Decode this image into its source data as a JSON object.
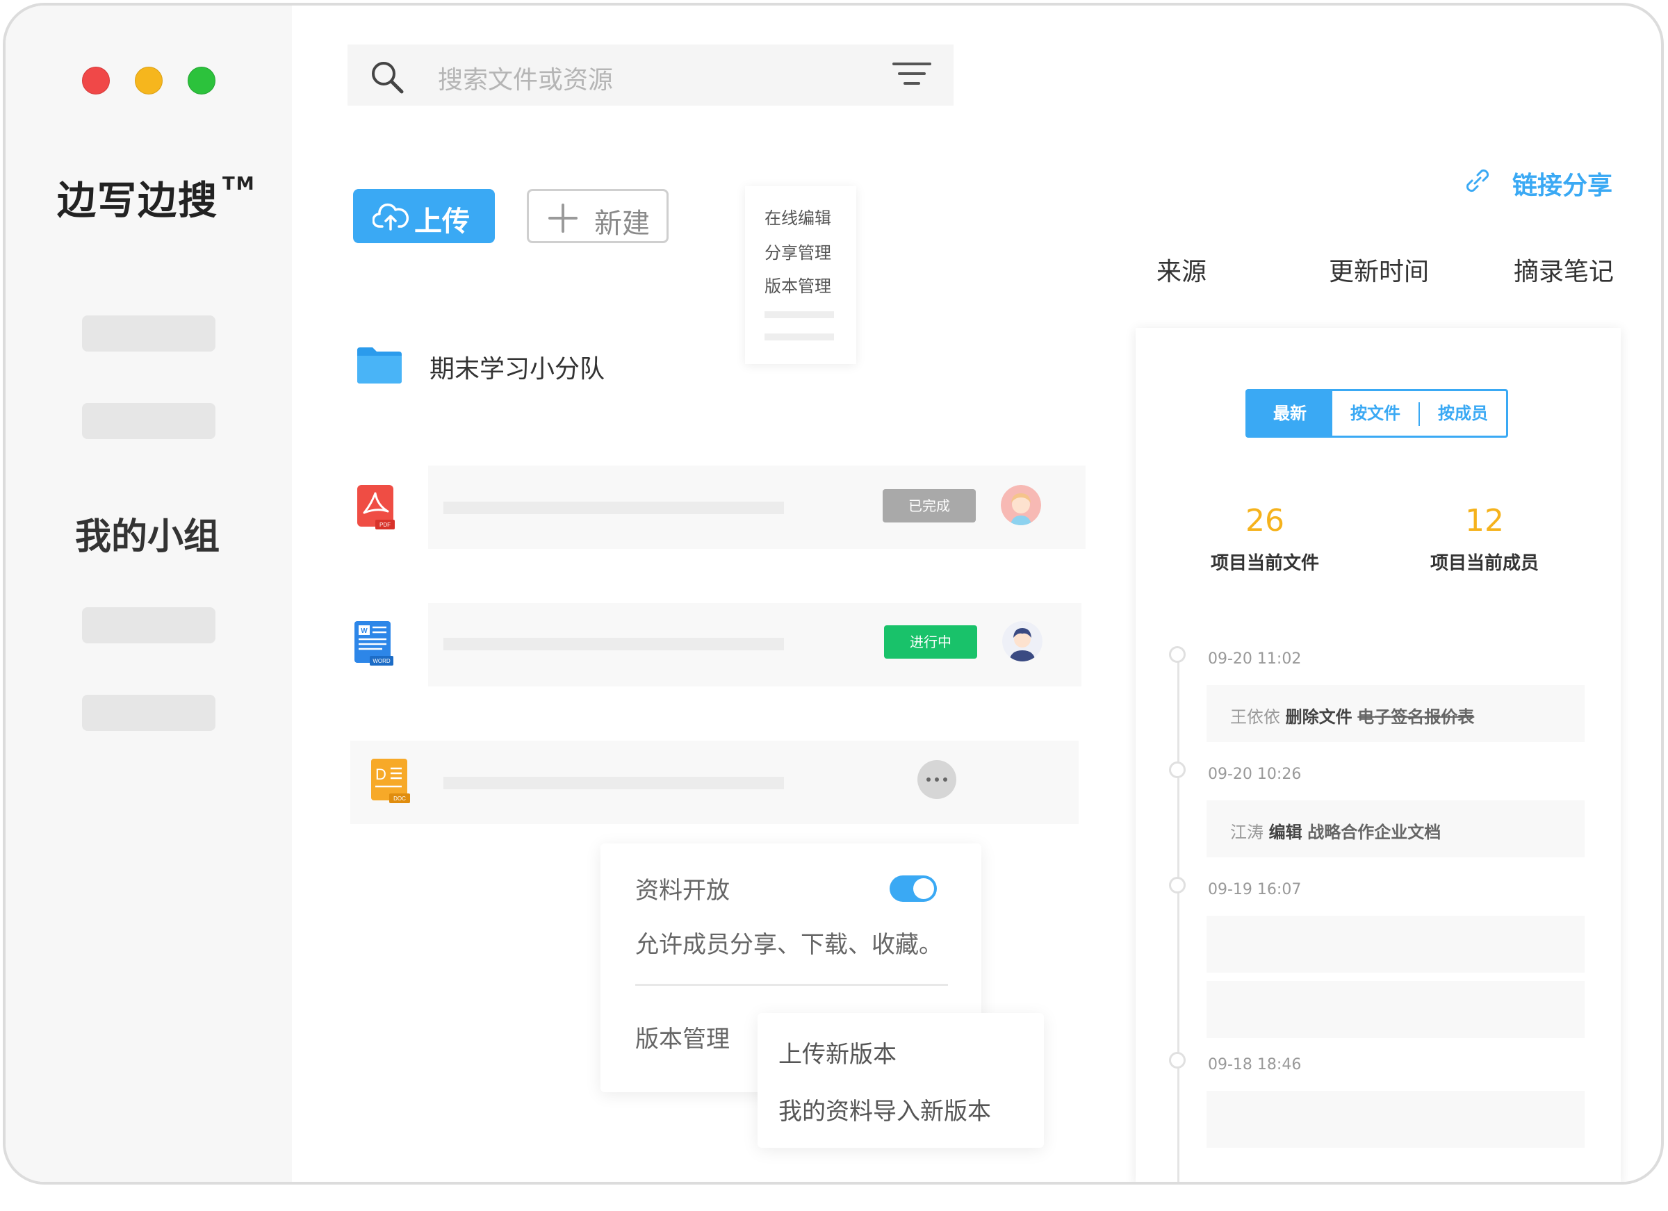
{
  "brand": {
    "name": "边写边搜",
    "tm": "TM"
  },
  "sidebar": {
    "section_title": "我的小组"
  },
  "search": {
    "placeholder": "搜索文件或资源"
  },
  "toolbar": {
    "upload_label": "上传",
    "new_label": "新建"
  },
  "context_menu": {
    "items": [
      "在线编辑",
      "分享管理",
      "版本管理"
    ]
  },
  "folder": {
    "name": "期末学习小分队"
  },
  "files": [
    {
      "icon": "pdf-file-icon",
      "badge": "PDF",
      "status": "已完成"
    },
    {
      "icon": "word-file-icon",
      "badge": "WORD",
      "status": "进行中"
    },
    {
      "icon": "doc-file-icon",
      "badge": "DOC"
    }
  ],
  "share_panel": {
    "title": "资料开放",
    "toggle_on": true,
    "description": "允许成员分享、下载、收藏。",
    "version_label": "版本管理"
  },
  "version_menu": {
    "items": [
      "上传新版本",
      "我的资料导入新版本"
    ]
  },
  "link_share": {
    "label": "链接分享"
  },
  "columns": [
    "来源",
    "更新时间",
    "摘录笔记"
  ],
  "activity": {
    "tabs": [
      "最新",
      "按文件",
      "按成员"
    ],
    "active_tab": "最新",
    "stats": [
      {
        "value": "26",
        "label": "项目当前文件"
      },
      {
        "value": "12",
        "label": "项目当前成员"
      }
    ],
    "timeline": [
      {
        "time": "09-20 11:02",
        "user": "王依依",
        "action": "删除文件",
        "target": "电子签名报价表"
      },
      {
        "time": "09-20 10:26",
        "user": "江涛",
        "action": "编辑",
        "target": "战略合作企业文档"
      },
      {
        "time": "09-19 16:07"
      },
      {
        "time": "09-18 18:46"
      }
    ]
  },
  "colors": {
    "accent": "#3aa9f4",
    "done_badge": "#a9a9a9",
    "progress_badge": "#19c26a",
    "stat_number": "#f5b21c",
    "traffic_red": "#f04848",
    "traffic_yellow": "#f6b61d",
    "traffic_green": "#2cc23c"
  }
}
